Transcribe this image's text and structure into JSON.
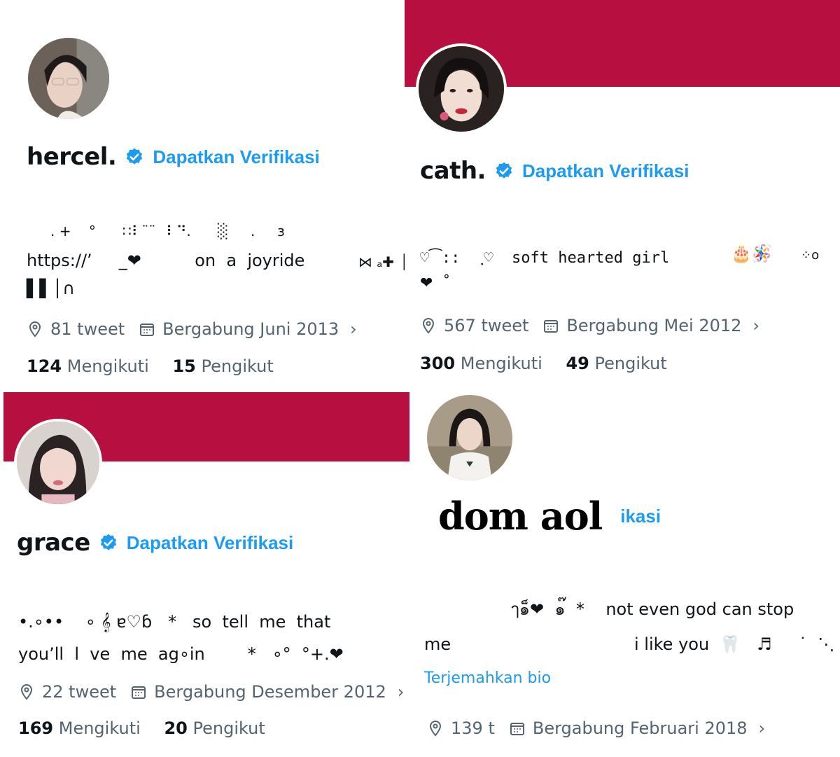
{
  "colors": {
    "banner": "#b80f41",
    "verified": "#1d9bf0",
    "link": "#1d9bf0",
    "muted": "#536471",
    "text": "#0f1419"
  },
  "profiles": [
    {
      "display_name": "hercel.",
      "verify_label": "Dapatkan Verifikasi",
      "bio_line1": "https://’     _❤          on  a  joyride",
      "bio_line2": "▌▌│∩",
      "deco_line": ". +    °      ∷⠇¨¨⠀⠇⠙.      ░     .     з",
      "tweets": "81 tweet",
      "joined": "Bergabung Juni 2013",
      "following_count": "124",
      "following_label": "Mengikuti",
      "followers_count": "15",
      "followers_label": "Pengikut",
      "avatar_icon": "profile-photo"
    },
    {
      "display_name": "cath.",
      "verify_label": "Dapatkan Verifikasi",
      "bio_line1": "♡⁀::   ฺ♡  soft hearted girl",
      "bio_line2": "❤  ˚",
      "tweets": "567 tweet",
      "joined": "Bergabung Mei 2012",
      "following_count": "300",
      "following_label": "Mengikuti",
      "followers_count": "49",
      "followers_label": "Pengikut",
      "avatar_icon": "profile-photo"
    },
    {
      "display_name": "grace",
      "verify_label": "Dapatkan Verifikasi",
      "bio_line1": "•.∘••    ∘ 𝄞 ɐ♡ɓ   *   so  tell  me  that",
      "bio_line2": "you’ll  l  ve  me  ag∘in        *   ∘°  °+.❤",
      "tweets": "22 tweet",
      "joined": "Bergabung Desember 2012",
      "following_count": "169",
      "following_label": "Mengikuti",
      "followers_count": "20",
      "followers_label": "Pengikut",
      "avatar_icon": "profile-photo"
    },
    {
      "display_name": "dom aol",
      "verify_label": "ikasi",
      "bio_line1": "ๅ๑็❤  ๑๊  *    not even god can stop",
      "bio_line2": "me",
      "bio_line3": "i like you  🦷   ♬     ˙  ⋱",
      "translate_label": "Terjemahkan bio",
      "tweets": "139 t",
      "joined": "Bergabung Februari 2018",
      "avatar_icon": "profile-photo"
    }
  ],
  "icons": {
    "location": "location-icon",
    "calendar": "calendar-icon",
    "verified": "verified-badge-icon",
    "chevron": "chevron-right-icon"
  }
}
